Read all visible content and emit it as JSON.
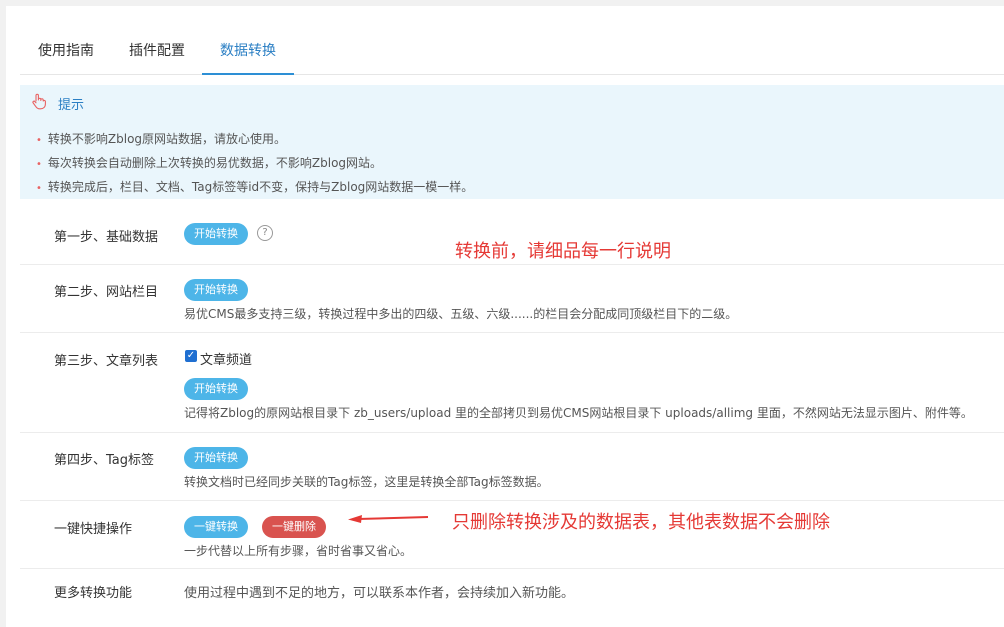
{
  "tabs": [
    "使用指南",
    "插件配置",
    "数据转换"
  ],
  "tips": {
    "title": "提示",
    "items": [
      "转换不影响Zblog原网站数据，请放心使用。",
      "每次转换会自动删除上次转换的易优数据，不影响Zblog网站。",
      "转换完成后，栏目、文档、Tag标签等id不变，保持与Zblog网站数据一模一样。"
    ]
  },
  "rows": [
    {
      "label": "第一步、基础数据",
      "button": "开始转换",
      "help": "?"
    },
    {
      "label": "第二步、网站栏目",
      "button": "开始转换",
      "desc": "易优CMS最多支持三级，转换过程中多出的四级、五级、六级......的栏目会分配成同顶级栏目下的二级。"
    },
    {
      "label": "第三步、文章列表",
      "checkbox_label": "文章频道",
      "button": "开始转换",
      "desc": "记得将Zblog的原网站根目录下 zb_users/upload 里的全部拷贝到易优CMS网站根目录下 uploads/allimg 里面，不然网站无法显示图片、附件等。"
    },
    {
      "label": "第四步、Tag标签",
      "button": "开始转换",
      "desc": "转换文档时已经同步关联的Tag标签，这里是转换全部Tag标签数据。"
    },
    {
      "label": "一键快捷操作",
      "button": "一键转换",
      "button2": "一键删除",
      "desc": "一步代替以上所有步骤，省时省事又省心。"
    },
    {
      "label": "更多转换功能",
      "desc": "使用过程中遇到不足的地方，可以联系本作者，会持续加入新功能。"
    }
  ],
  "annotations": {
    "top": "转换前，请细品每一行说明",
    "delete": "只删除转换涉及的数据表，其他表数据不会删除"
  },
  "colors": {
    "accent": "#2d8fd5",
    "button": "#4db5e8",
    "danger": "#d9534f",
    "note": "#e53935",
    "tips_bg": "#eaf6fc"
  }
}
